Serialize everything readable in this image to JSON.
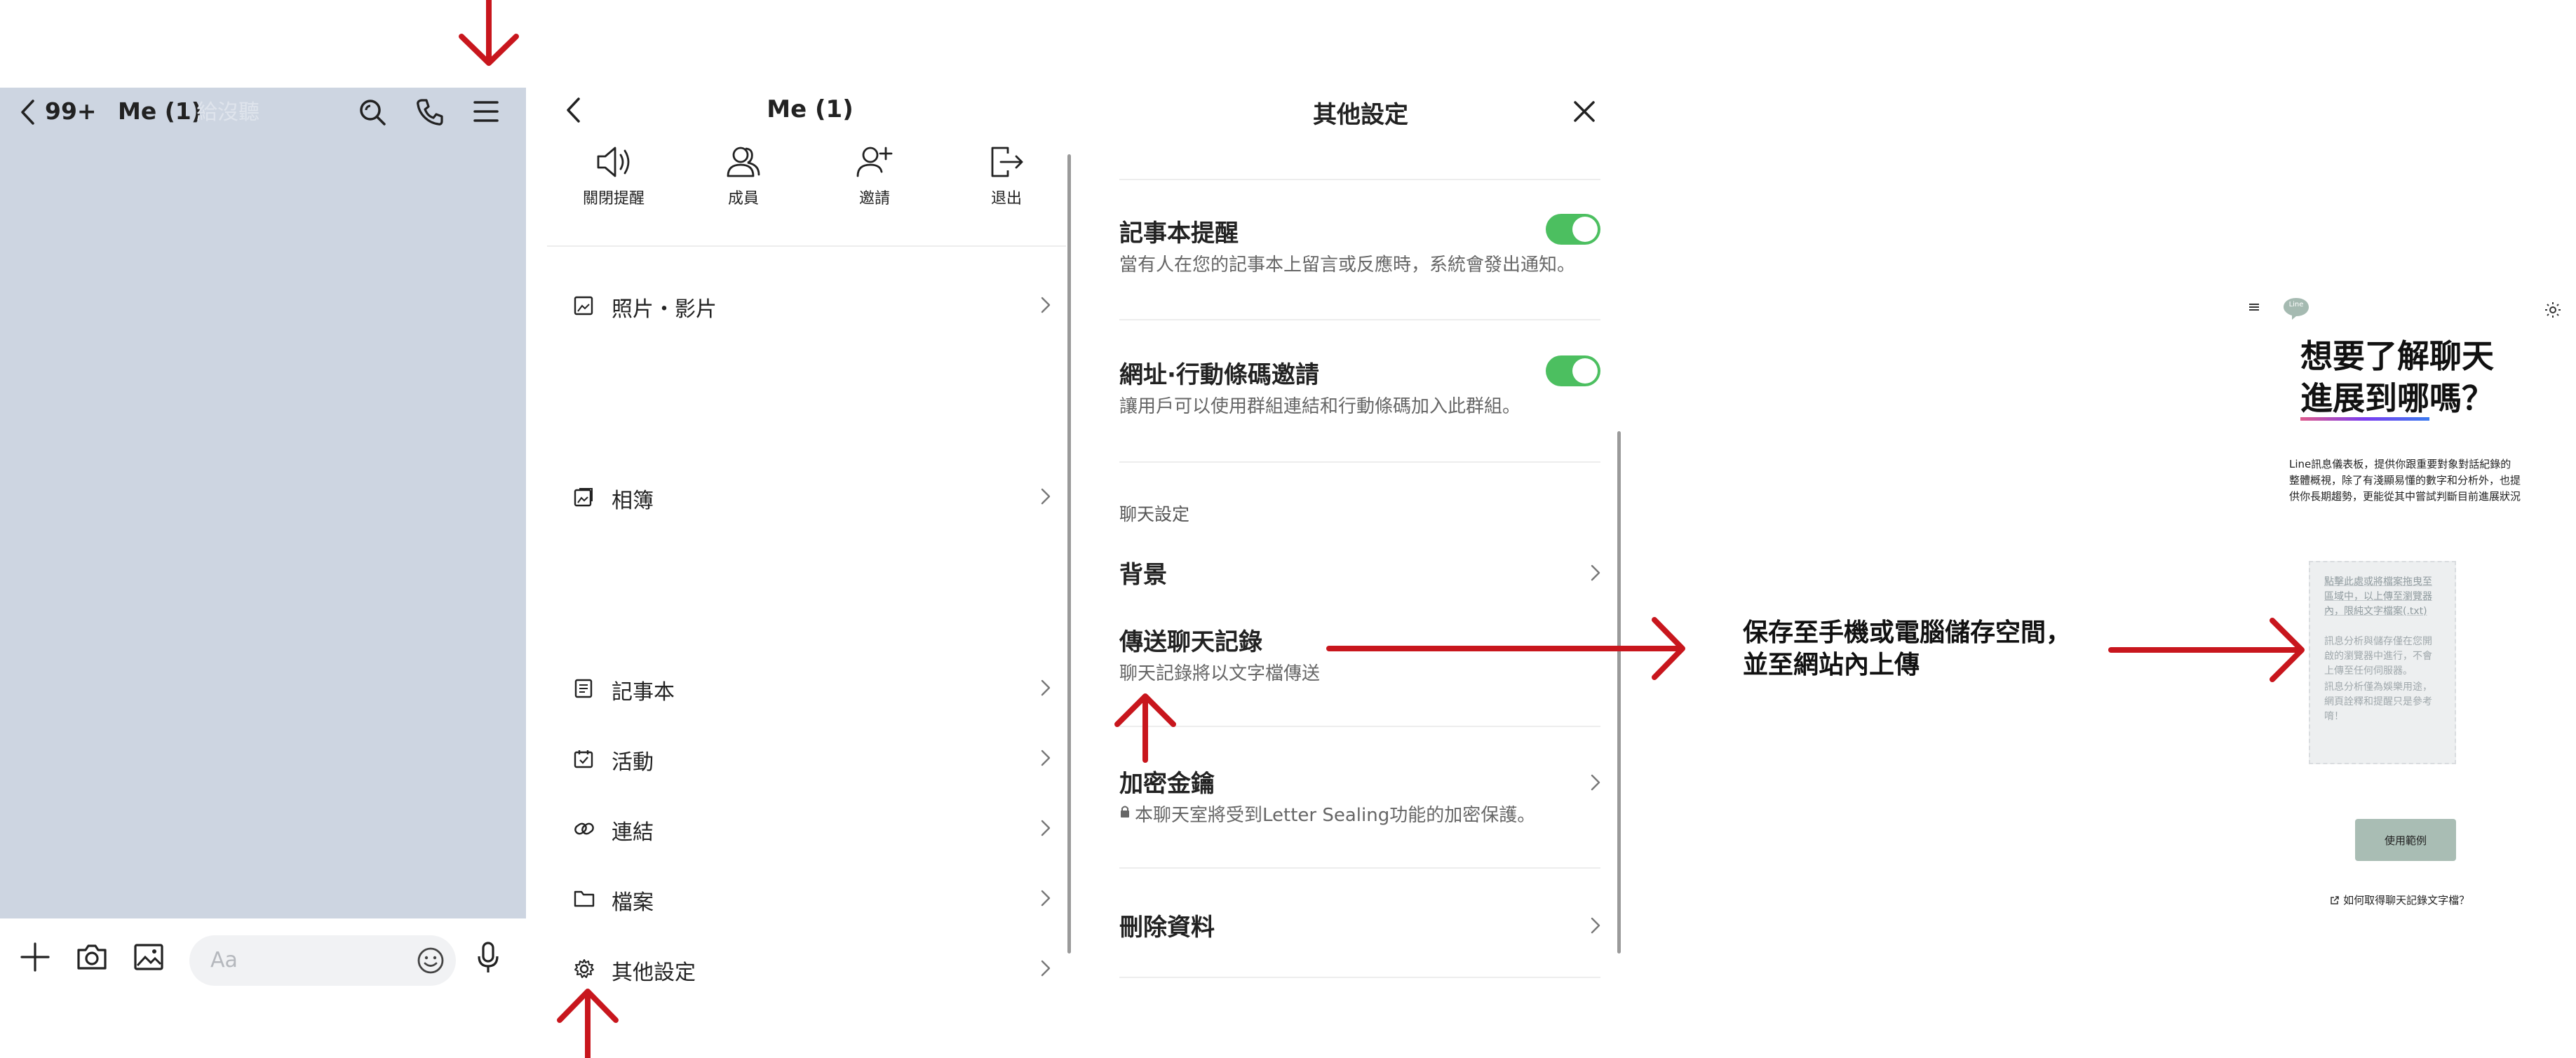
{
  "colors": {
    "accent_green": "#4CBF60",
    "arrow_red": "#C8161D",
    "chat_bg": "#CDD5E1",
    "panel_line": "#EDEDED"
  },
  "chat_screen": {
    "back_count": "99+",
    "title": "Me (1)",
    "faint_text": "給沒聽",
    "input_placeholder": "Aa",
    "icons": [
      "back-chevron-icon",
      "search-icon",
      "phone-icon",
      "menu-icon",
      "plus-icon",
      "camera-icon",
      "image-icon",
      "emoji-icon",
      "mic-icon"
    ]
  },
  "menu_screen": {
    "title": "Me (1)",
    "actions": [
      {
        "label": "關閉提醒",
        "icon": "speaker-icon"
      },
      {
        "label": "成員",
        "icon": "members-icon"
      },
      {
        "label": "邀請",
        "icon": "add-user-icon"
      },
      {
        "label": "退出",
        "icon": "exit-icon"
      }
    ],
    "items": [
      {
        "label": "照片・影片",
        "icon": "photo-icon"
      },
      {
        "label": "相簿",
        "icon": "album-icon"
      },
      {
        "label": "記事本",
        "icon": "note-icon"
      },
      {
        "label": "活動",
        "icon": "calendar-icon"
      },
      {
        "label": "連結",
        "icon": "link-icon"
      },
      {
        "label": "檔案",
        "icon": "folder-icon"
      },
      {
        "label": "其他設定",
        "icon": "gear-icon"
      }
    ]
  },
  "settings_screen": {
    "title": "其他設定",
    "note_reminder": {
      "title": "記事本提醒",
      "desc": "當有人在您的記事本上留言或反應時，系統會發出通知。",
      "enabled": true
    },
    "url_invite": {
      "title": "網址·行動條碼邀請",
      "desc": "讓用戶可以使用群組連結和行動條碼加入此群組。",
      "enabled": true
    },
    "section_label": "聊天設定",
    "background": {
      "title": "背景"
    },
    "send_history": {
      "title": "傳送聊天記錄",
      "desc": "聊天記錄將以文字檔傳送"
    },
    "encryption": {
      "title": "加密金鑰",
      "desc": "本聊天室將受到Letter Sealing功能的加密保護。"
    },
    "delete_data": {
      "title": "刪除資料"
    }
  },
  "annotation": {
    "line1": "保存至手機或電腦儲存空間，",
    "line2": "並至網站內上傳"
  },
  "web_page": {
    "logo_text": "Line",
    "headline_line1": "想要了解聊天",
    "headline_line2_highlight": "進展到哪",
    "headline_line2_tail": "嗎？",
    "description": "Line訊息儀表板，提供你跟重要對象對話紀錄的整體概視，除了有淺顯易懂的數字和分析外，也提供你長期趨勢，更能從其中嘗試判斷目前進展狀況",
    "upload_box_text": "點擊此處或將檔案拖曳至區域中，以上傳至瀏覽器內，限純文字檔案(.txt)",
    "upload_note1": "訊息分析與儲存僅在您開啟的瀏覽器中進行，不會上傳至任何伺服器。",
    "upload_note2": "訊息分析僅為娛樂用途，網頁詮釋和提醒只是參考唷！",
    "example_button": "使用範例",
    "help_link": "如何取得聊天記錄文字檔？"
  }
}
